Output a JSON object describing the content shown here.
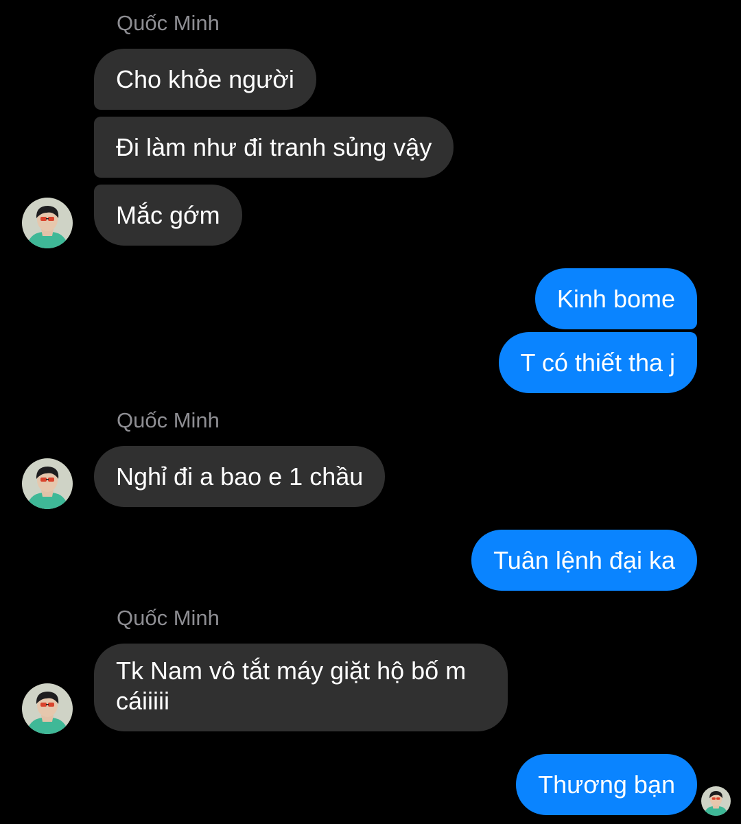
{
  "conversation": {
    "contact_name": "Quốc Minh",
    "groups": [
      {
        "sender": "Quốc Minh",
        "messages": [
          "Cho khỏe người",
          "Đi làm như đi tranh sủng vậy",
          "Mắc gớm"
        ]
      },
      {
        "sender": "me",
        "messages": [
          "Kinh bome",
          "T có thiết tha j"
        ]
      },
      {
        "sender": "Quốc Minh",
        "messages": [
          "Nghỉ đi a bao e 1 chầu"
        ]
      },
      {
        "sender": "me",
        "messages": [
          "Tuân lệnh đại ka"
        ]
      },
      {
        "sender": "Quốc Minh",
        "messages": [
          "Tk Nam vô tắt máy giặt hộ bố m cáiiiii"
        ]
      },
      {
        "sender": "me",
        "messages": [
          "Thương bạn"
        ]
      }
    ]
  },
  "colors": {
    "background": "#000000",
    "incoming_bubble": "#303030",
    "outgoing_bubble": "#0a84ff",
    "sender_label": "#8e8e93"
  },
  "icons": {
    "contact_avatar": "contact-avatar-icon",
    "read_receipt": "read-receipt-avatar-icon"
  }
}
